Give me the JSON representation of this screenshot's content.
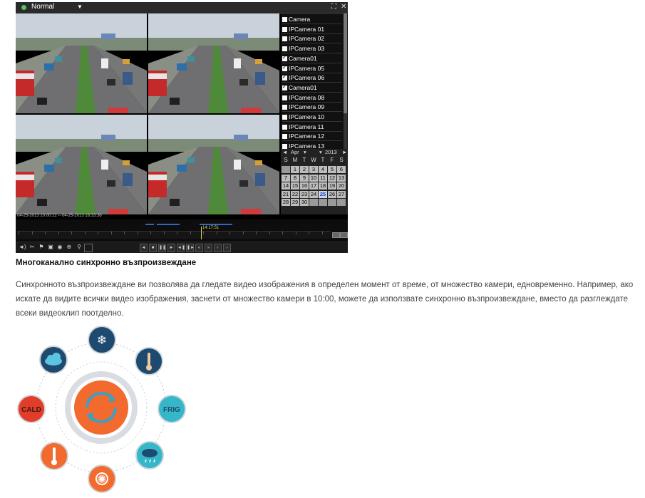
{
  "dvr": {
    "mode_label": "Normal",
    "timestamp_range": "04-25-2013 10:00:12 -- 04-25-2013 18:33:36",
    "cursor_time": "14:17:51",
    "camera_list": [
      {
        "label": "Camera",
        "checked": false
      },
      {
        "label": "IPCamera 01",
        "checked": false
      },
      {
        "label": "IPCamera 02",
        "checked": false
      },
      {
        "label": "IPCamera 03",
        "checked": false
      },
      {
        "label": "Camera01",
        "checked": true
      },
      {
        "label": "IPCamera 05",
        "checked": true
      },
      {
        "label": "IPCamera 06",
        "checked": true
      },
      {
        "label": "Camera01",
        "checked": true
      },
      {
        "label": "IPCamera 08",
        "checked": false
      },
      {
        "label": "IPCamera 09",
        "checked": false
      },
      {
        "label": "IPCamera 10",
        "checked": false
      },
      {
        "label": "IPCamera 11",
        "checked": false
      },
      {
        "label": "IPCamera 12",
        "checked": false
      },
      {
        "label": "IPCamera 13",
        "checked": false
      }
    ],
    "calendar": {
      "month": "Apr",
      "year": "2013",
      "weekdays": [
        "S",
        "M",
        "T",
        "W",
        "T",
        "F",
        "S"
      ],
      "start_weekday": 1,
      "days_in_month": 30,
      "highlighted_day": 25
    },
    "accent_color": "#3465c8",
    "cursor_color": "#e2d24a"
  },
  "article": {
    "heading": "Многоканално синхронно възпроизвеждане",
    "body": "Синхронното възпроизвеждане ви позволява да гледате видео изображения в определен момент от време, от множество камери, едновременно. Например, ако искате да видите всички видео изображения, заснети от множество камери в 10:00, можете да използвате синхронно възпроизвеждане, вместо да разглеждате всеки видеоклип поотделно."
  },
  "graphic": {
    "center_color": "#f26a2e",
    "node_labels": {
      "cold": "CALD",
      "frig": "FRIG"
    },
    "nodes": [
      {
        "name": "snowflake-icon",
        "color": "#1d4a6e"
      },
      {
        "name": "thermometer-cold-icon",
        "color": "#1d4a6e"
      },
      {
        "name": "frig-label",
        "color": "#36b7c9"
      },
      {
        "name": "rain-cloud-icon",
        "color": "#36b7c9"
      },
      {
        "name": "sun-icon",
        "color": "#f26a2e"
      },
      {
        "name": "thermometer-hot-icon",
        "color": "#f26a2e"
      },
      {
        "name": "cald-label",
        "color": "#e23d2a"
      },
      {
        "name": "cloud-icon",
        "color": "#1d4a6e"
      }
    ]
  }
}
